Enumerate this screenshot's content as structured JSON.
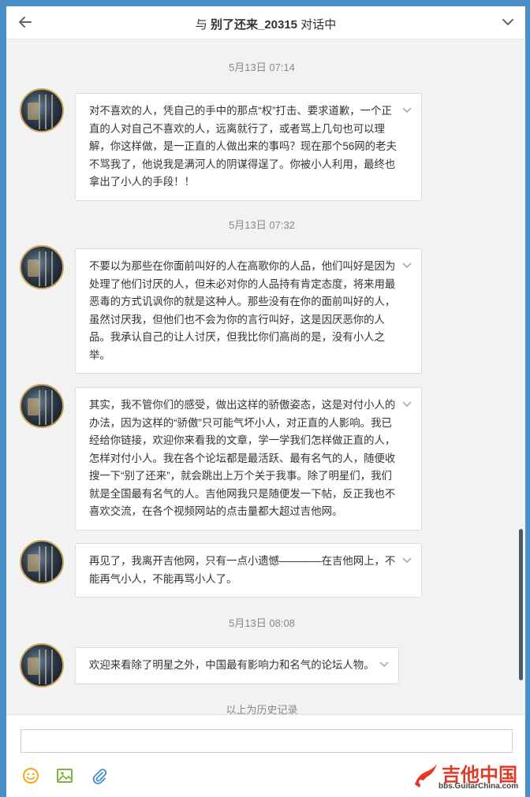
{
  "header": {
    "prefix": "与",
    "contact": "别了还来_20315",
    "suffix": "对话中"
  },
  "messages": [
    {
      "timestamp": "5月13日 07:14",
      "text": "对不喜欢的人，凭自己的手中的那点“权”打击、要求道歉，一个正直的人对自己不喜欢的人，远离就行了，或者骂上几句也可以理解，你这样做，是一正直的人做出来的事吗？现在那个56网的老夫不骂我了，他说我是满河人的阴谋得逞了。你被小人利用，最终也拿出了小人的手段！！"
    },
    {
      "timestamp": "5月13日 07:32",
      "text": "不要以为那些在你面前叫好的人在高歌你的人品，他们叫好是因为处理了他们讨厌的人，但未必对你的人品持有肯定态度，将来用最恶毒的方式讥讽你的就是这种人。那些没有在你的面前叫好的人，虽然讨厌我，但他们也不会为你的言行叫好，这是因厌恶你的人品。我承认自己的让人讨厌，但我比你们高尚的是，没有小人之举。"
    },
    {
      "timestamp": "",
      "text": "其实，我不管你们的感受，做出这样的骄傲姿态，这是对付小人的办法，因为这样的“骄傲”只可能气坏小人，对正直的人影响。我已经给你链接，欢迎你来看我的文章，学一学我们怎样做正直的人，怎样对付小人。我在各个论坛都是最活跃、最有名气的人，随便收搜一下“别了还来”，就会跳出上万个关于我事。除了明星们，我们就是全国最有名气的人。吉他网我只是随便发一下帖，反正我也不喜欢交流，在各个视频网站的点击量都大超过吉他网。"
    },
    {
      "timestamp": "",
      "text": "再见了，我离开吉他网，只有一点小遗憾————在吉他网上，不能再气小人，不能再骂小人了。"
    },
    {
      "timestamp": "5月13日 08:08",
      "text": "欢迎来看除了明星之外，中国最有影响力和名气的论坛人物。"
    }
  ],
  "history_label": "以上为历史记录",
  "composer": {
    "placeholder": "",
    "tools": [
      "emoji-icon",
      "image-icon",
      "attachment-icon"
    ]
  },
  "watermark": {
    "title": "吉他中国",
    "url": "bbs.GuitarChina.com"
  },
  "colors": {
    "accent": "#4a90c8",
    "emoji": "#f5a623",
    "image": "#7cb342",
    "attachment": "#3d8fd1",
    "logo": "#e23a2a"
  }
}
